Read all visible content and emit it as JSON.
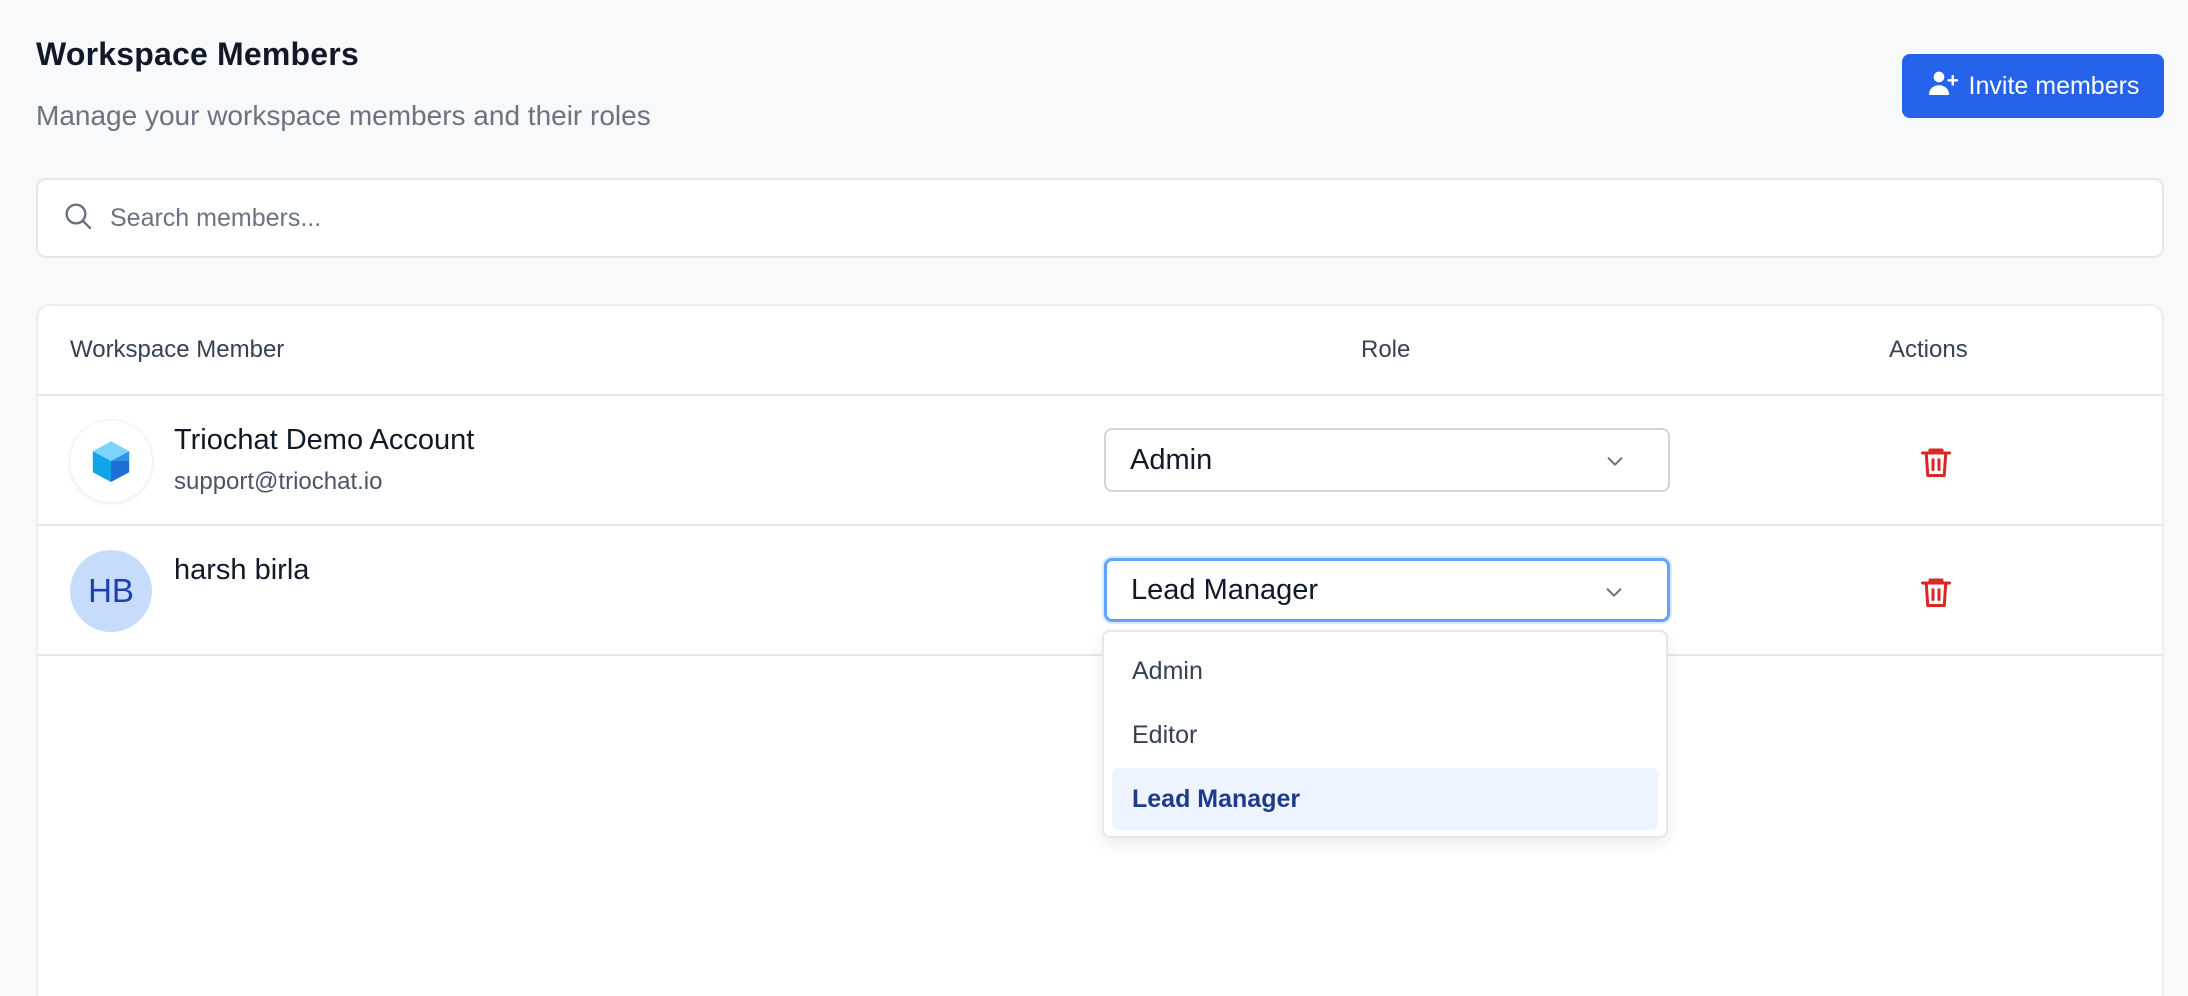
{
  "header": {
    "title": "Workspace Members",
    "subtitle": "Manage your workspace members and their roles",
    "invite_label": "Invite members",
    "invite_icon": "user-plus-icon"
  },
  "search": {
    "placeholder": "Search members...",
    "value": "",
    "icon": "search-icon"
  },
  "table": {
    "columns": [
      "Workspace Member",
      "Role",
      "Actions"
    ],
    "rows": [
      {
        "name": "Triochat Demo Account",
        "email": "support@triochat.io",
        "avatar": "triochat-cube-logo",
        "role": "Admin"
      },
      {
        "name": "harsh birla",
        "email": "",
        "initials": "HB",
        "role": "Lead Manager"
      }
    ]
  },
  "role_dropdown": {
    "options": [
      "Admin",
      "Editor",
      "Lead Manager"
    ],
    "selected": "Lead Manager"
  },
  "colors": {
    "primary": "#2563eb",
    "danger": "#dc2626",
    "focus_ring": "#60a5fa",
    "selected_option_bg": "#eef4fe",
    "avatar_bg": "#c7dcfb"
  }
}
